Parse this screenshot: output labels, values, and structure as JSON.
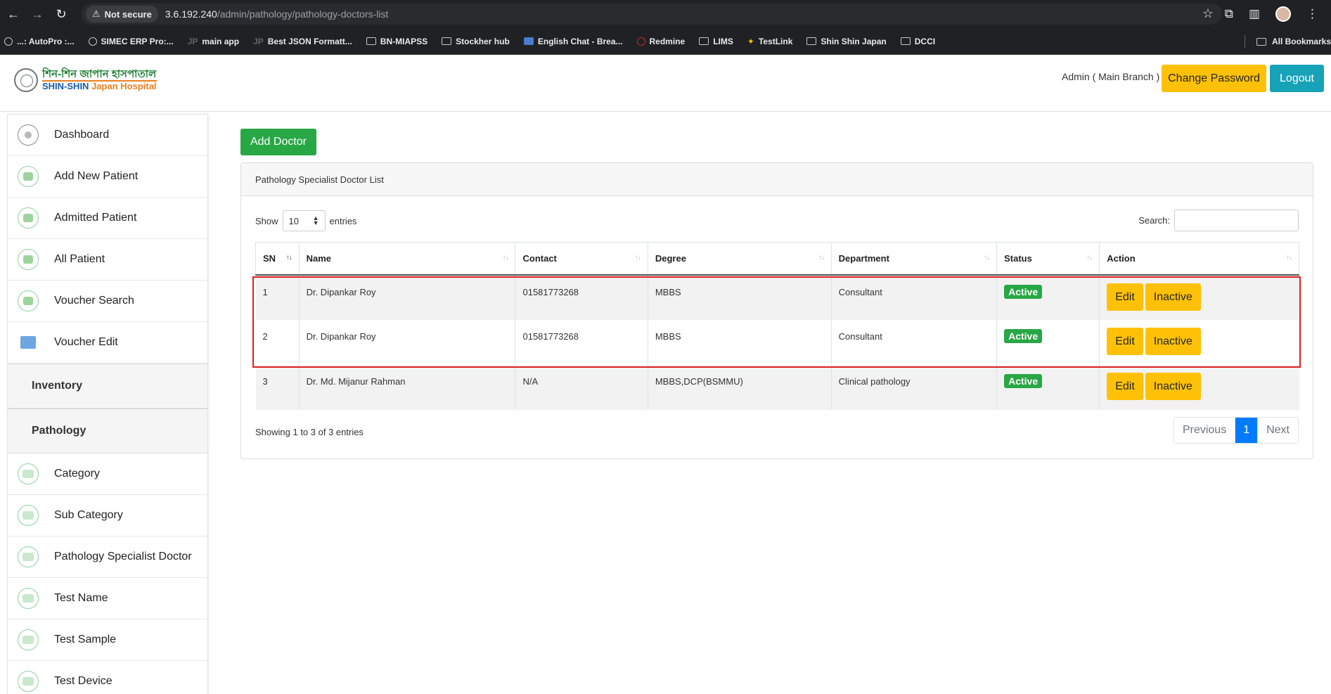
{
  "browser": {
    "security_label": "Not secure",
    "url_host": "3.6.192.240",
    "url_path": "/admin/pathology/pathology-doctors-list",
    "bookmarks": [
      "...: AutoPro :...",
      "SIMEC ERP Pro:...",
      "main app",
      "Best JSON Formatt...",
      "BN-MIAPSS",
      "Stockher hub",
      "English Chat - Brea...",
      "Redmine",
      "LIMS",
      "TestLink",
      "Shin Shin Japan",
      "DCCI"
    ],
    "all_bookmarks": "All Bookmarks"
  },
  "header": {
    "logo_bn": "শিন-শিন জাপান হাসপাতাল",
    "logo_en_1": "SHIN-SHIN",
    "logo_en_2": "Japan Hospital",
    "user": "Admin ( Main Branch )",
    "change_password": "Change Password",
    "logout": "Logout"
  },
  "sidebar": {
    "items_top": [
      "Dashboard",
      "Add New Patient",
      "Admitted Patient",
      "All Patient",
      "Voucher Search",
      "Voucher Edit"
    ],
    "section_inventory": "Inventory",
    "section_pathology": "Pathology",
    "items_pathology": [
      "Category",
      "Sub Category",
      "Pathology Specialist Doctor",
      "Test Name",
      "Test Sample",
      "Test Device"
    ]
  },
  "main": {
    "add_doctor": "Add Doctor",
    "card_title": "Pathology Specialist Doctor List",
    "show_label": "Show",
    "page_length": "10",
    "entries_label": "entries",
    "search_label": "Search:",
    "columns": [
      "SN",
      "Name",
      "Contact",
      "Degree",
      "Department",
      "Status",
      "Action"
    ],
    "rows": [
      {
        "sn": "1",
        "name": "Dr. Dipankar Roy",
        "contact": "01581773268",
        "degree": "MBBS",
        "department": "Consultant",
        "status": "Active",
        "edit": "Edit",
        "inactive": "Inactive"
      },
      {
        "sn": "2",
        "name": "Dr. Dipankar Roy",
        "contact": "01581773268",
        "degree": "MBBS",
        "department": "Consultant",
        "status": "Active",
        "edit": "Edit",
        "inactive": "Inactive"
      },
      {
        "sn": "3",
        "name": "Dr. Md. Mijanur Rahman",
        "contact": "N/A",
        "degree": "MBBS,DCP(BSMMU)",
        "department": "Clinical pathology",
        "status": "Active",
        "edit": "Edit",
        "inactive": "Inactive"
      }
    ],
    "info": "Showing 1 to 3 of 3 entries",
    "pager": {
      "previous": "Previous",
      "current": "1",
      "next": "Next"
    }
  }
}
